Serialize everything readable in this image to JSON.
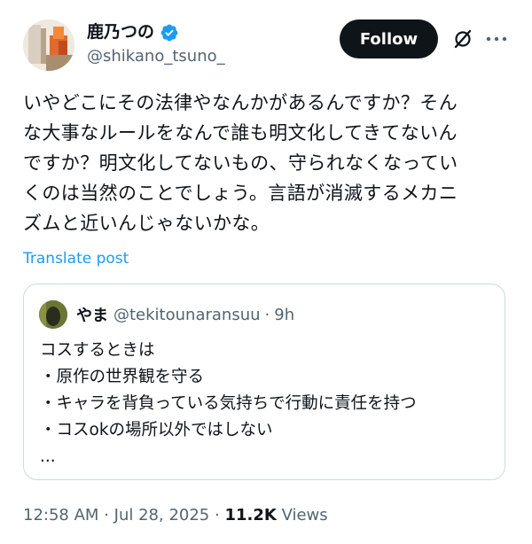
{
  "author": {
    "display_name": "鹿乃つの",
    "handle": "@shikano_tsuno_",
    "verified": true,
    "verified_color": "#1d9bf0",
    "avatar_icon": "photo-avatar"
  },
  "actions": {
    "follow_label": "Follow",
    "grok_icon": "grok-icon",
    "more_icon": "more-options-icon"
  },
  "tweet": {
    "lines": [
      "いやどこにその法律やなんかがあるんですか？そん",
      "な大事なルールをなんで誰も明文化してきてないん",
      "ですか？明文化してないもの、守られなくなってい",
      "くのは当然のことでしょう。言語が消滅するメカニ",
      "ズムと近いんじゃないかな。"
    ],
    "translate_label": "Translate post"
  },
  "quote": {
    "display_name": "やま",
    "handle": "@tekitounaransuu",
    "separator": "·",
    "time": "9h",
    "lines": [
      "コスするときは",
      "・原作の世界観を守る",
      "・キャラを背負っている気持ちで行動に責任を持つ",
      "・コスokの場所以外ではしない",
      "..."
    ]
  },
  "meta": {
    "time": "12:58 AM",
    "separator1": "·",
    "date": "Jul 28, 2025",
    "separator2": "·",
    "views_count": "11.2K",
    "views_label": "Views"
  },
  "colors": {
    "link": "#1d9bf0",
    "secondary_text": "#536471",
    "primary_text": "#0f1419",
    "border": "#cfd9de"
  }
}
